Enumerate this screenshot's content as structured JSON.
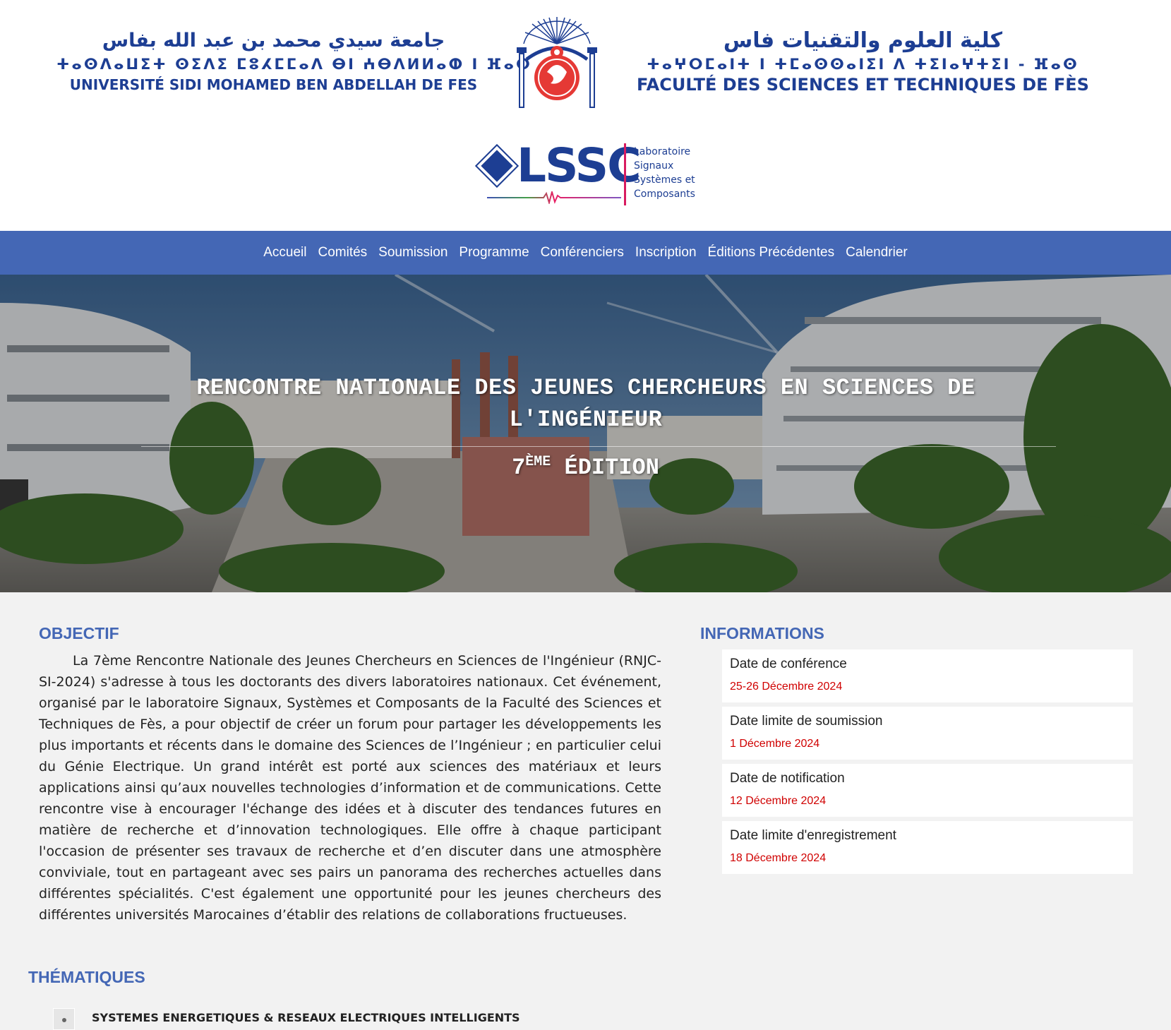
{
  "header": {
    "university": {
      "arabic": "جامعة سيدي محمد بن عبد الله بفاس",
      "tifinagh": "ⵜⴰⵙⴷⴰⵡⵉⵜ ⵙⵉⴷⵉ ⵎⵓⵃⵎⵎⴰⴷ ⴱⵏ ⵄⴱⴷⵍⵍⴰⵀ ⵏ ⴼⴰⵙ",
      "latin": "UNIVERSITÉ SIDI MOHAMED BEN ABDELLAH DE FES"
    },
    "faculty": {
      "arabic": "كلية العلوم والتقنيات فاس",
      "tifinagh": "ⵜⴰⵖⵔⵎⴰⵏⵜ ⵏ ⵜⵎⴰⵙⵙⴰⵏⵉⵏ ⴷ ⵜⵉⵏⴰⵖⵜⵉⵏ - ⴼⴰⵙ",
      "latin": "FACULTÉ DES SCIENCES ET TECHNIQUES DE FÈS"
    },
    "emblem_icon": "university-emblem-icon",
    "lab_logo": {
      "acronym": "LSSC",
      "line1": "Laboratoire",
      "line2": "Signaux",
      "line3": "Systèmes et",
      "line4": "Composants"
    }
  },
  "nav": {
    "items": [
      "Accueil",
      "Comités",
      "Soumission",
      "Programme",
      "Conférenciers",
      "Inscription",
      "Éditions Précédentes",
      "Calendrier"
    ]
  },
  "hero": {
    "title": "RENCONTRE NATIONALE DES JEUNES CHERCHEURS EN SCIENCES DE L'INGÉNIEUR",
    "edition_number": "7",
    "edition_suffix": "ÈME",
    "edition_label": "ÉDITION"
  },
  "objectif": {
    "title": "OBJECTIF",
    "text": "La 7ème Rencontre Nationale des Jeunes Chercheurs en Sciences de l'Ingénieur (RNJC-SI-2024) s'adresse à tous les doctorants des divers laboratoires nationaux. Cet événement, organisé par le laboratoire Signaux, Systèmes et Composants de la Faculté des Sciences et Techniques de Fès, a pour objectif de créer un forum pour partager les développements les plus importants et récents dans le domaine des Sciences de l’Ingénieur ; en particulier celui du Génie Electrique. Un grand intérêt est porté aux sciences des matériaux et leurs applications ainsi qu’aux nouvelles technologies d’information et de communications. Cette rencontre vise à encourager l'échange des idées et à discuter des tendances futures en matière de recherche et d’innovation technologiques. Elle offre à chaque participant l'occasion de présenter ses travaux de recherche et d’en discuter dans une atmosphère conviviale, tout en partageant avec ses pairs un panorama des recherches actuelles dans différentes spécialités. C'est également une opportunité pour les jeunes chercheurs des différentes universités Marocaines d’établir des relations de collaborations fructueuses."
  },
  "informations": {
    "title": "INFORMATIONS",
    "items": [
      {
        "label": "Date de conférence",
        "date": "25-26 Décembre 2024"
      },
      {
        "label": "Date limite de soumission",
        "date": "1 Décembre 2024"
      },
      {
        "label": "Date de notification",
        "date": "12 Décembre 2024"
      },
      {
        "label": "Date limite d'enregistrement",
        "date": "18 Décembre 2024"
      }
    ]
  },
  "thematiques": {
    "title": "THÉMATIQUES",
    "items": [
      "SYSTEMES ENERGETIQUES & RESEAUX ELECTRIQUES INTELLIGENTS"
    ]
  },
  "colors": {
    "nav_bg": "#4467b5",
    "brand_blue": "#1d3e93",
    "date_red": "#d00000",
    "page_bg": "#f2f2f2"
  }
}
